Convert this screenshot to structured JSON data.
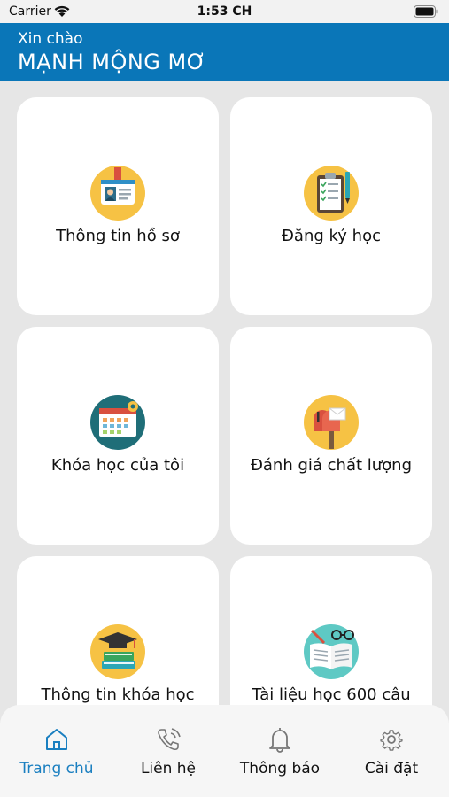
{
  "status_bar": {
    "carrier": "Carrier",
    "time": "1:53 CH"
  },
  "header": {
    "greeting": "Xin chào",
    "user_name": "MẠNH MỘNG MƠ"
  },
  "menu": [
    {
      "label": "Thông tin hồ sơ",
      "icon": "id-card-icon"
    },
    {
      "label": "Đăng ký học",
      "icon": "clipboard-checklist-icon"
    },
    {
      "label": "Khóa học của tôi",
      "icon": "calendar-icon"
    },
    {
      "label": "Đánh giá chất lượng",
      "icon": "mailbox-icon"
    },
    {
      "label": "Thông tin khóa học",
      "icon": "graduation-books-icon"
    },
    {
      "label": "Tài liệu học 600 câu",
      "icon": "open-book-glasses-icon"
    }
  ],
  "tabbar": [
    {
      "label": "Trang chủ",
      "icon": "home-icon",
      "active": true
    },
    {
      "label": "Liên hệ",
      "icon": "phone-icon",
      "active": false
    },
    {
      "label": "Thông báo",
      "icon": "bell-icon",
      "active": false
    },
    {
      "label": "Cài đặt",
      "icon": "gear-icon",
      "active": false
    }
  ],
  "colors": {
    "header": "#0a76b8",
    "active_tab": "#1a7fc0",
    "icon_circle_yellow": "#f6c244",
    "icon_circle_teal": "#1f6e78"
  }
}
